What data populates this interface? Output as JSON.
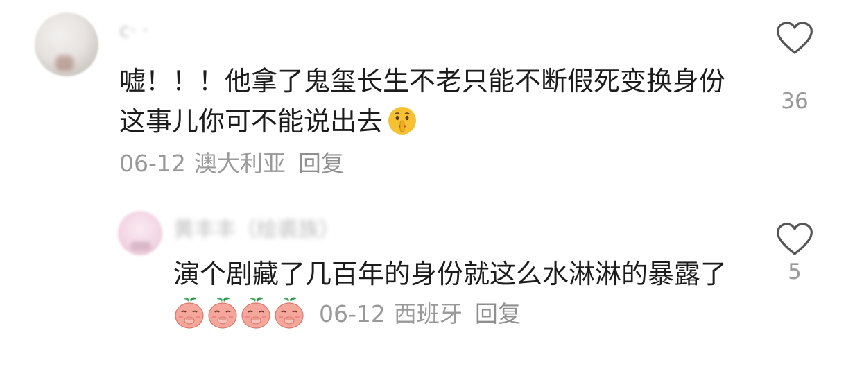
{
  "comments": [
    {
      "username": "c· ·",
      "text": "嘘！！！他拿了鬼玺长生不老只能不断假死变换身份这事儿你可不能说出去",
      "emoji": "shushing-face",
      "date": "06-12",
      "location": "澳大利亚",
      "reply_label": "回复",
      "like_count": "36"
    },
    {
      "username": "黄丰丰（绘裘族）",
      "text": "演个剧藏了几百年的身份就这么水淋淋的暴露了",
      "emoji": "peach-face-covering-mouth",
      "emoji_count": 4,
      "date": "06-12",
      "location": "西班牙",
      "reply_label": "回复",
      "like_count": "5"
    }
  ],
  "colors": {
    "text": "#1c1c1c",
    "meta": "#999999",
    "heart_outline": "#555555"
  }
}
